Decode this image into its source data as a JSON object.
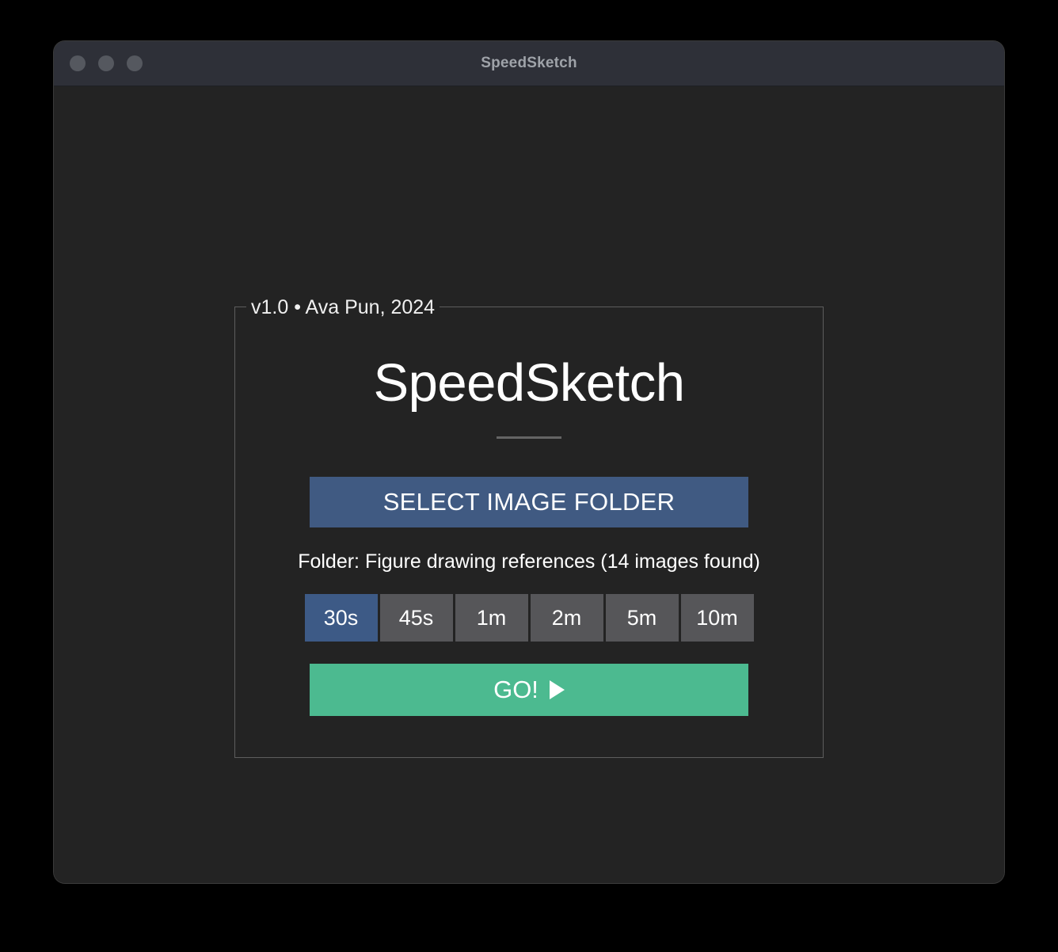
{
  "window": {
    "title": "SpeedSketch",
    "traffic_lights": [
      "close",
      "minimize",
      "maximize"
    ],
    "titlebar_bg": "#2e3038",
    "body_bg": "#232323"
  },
  "groupbox": {
    "legend": "v1.0 • Ava Pun, 2024"
  },
  "main": {
    "app_title": "SpeedSketch",
    "select_folder_label": "SELECT IMAGE FOLDER",
    "select_folder_color": "#405a82",
    "folder_status": "Folder: Figure drawing references (14 images found)",
    "durations": [
      {
        "label": "30s",
        "selected": true
      },
      {
        "label": "45s",
        "selected": false
      },
      {
        "label": "1m",
        "selected": false
      },
      {
        "label": "2m",
        "selected": false
      },
      {
        "label": "5m",
        "selected": false
      },
      {
        "label": "10m",
        "selected": false
      }
    ],
    "selected_duration": "30s",
    "duration_selected_color": "#3d5a86",
    "duration_idle_color": "#565659",
    "go_label": "GO!",
    "go_icon": "play-icon",
    "go_color": "#4cba90"
  }
}
